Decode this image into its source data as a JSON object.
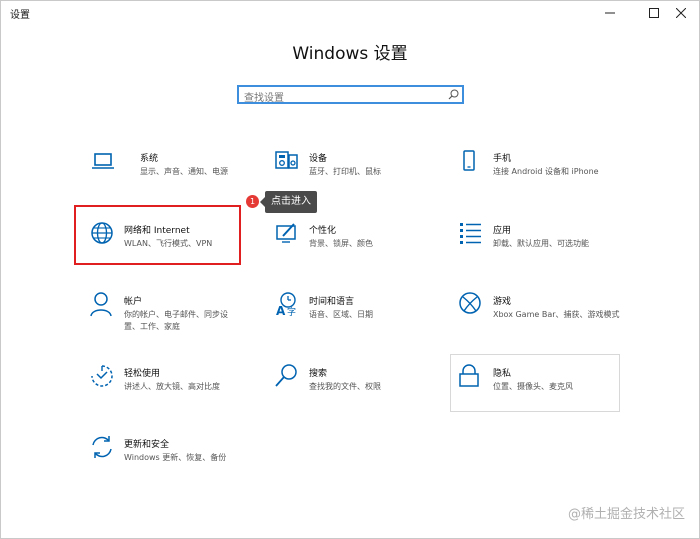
{
  "window": {
    "title": "设置"
  },
  "page": {
    "title": "Windows 设置"
  },
  "search": {
    "placeholder": "查找设置"
  },
  "callout": {
    "badge": "1",
    "text": "点击进入"
  },
  "tiles": [
    {
      "id": "system",
      "title": "系统",
      "subtitle": "显示、声音、通知、电源",
      "icon": "laptop-icon"
    },
    {
      "id": "devices",
      "title": "设备",
      "subtitle": "蓝牙、打印机、鼠标",
      "icon": "devices-icon"
    },
    {
      "id": "phone",
      "title": "手机",
      "subtitle": "连接 Android 设备和 iPhone",
      "icon": "phone-icon"
    },
    {
      "id": "network",
      "title": "网络和 Internet",
      "subtitle": "WLAN、飞行模式、VPN",
      "icon": "globe-icon"
    },
    {
      "id": "personalization",
      "title": "个性化",
      "subtitle": "背景、锁屏、颜色",
      "icon": "pen-screen-icon"
    },
    {
      "id": "apps",
      "title": "应用",
      "subtitle": "卸载、默认应用、可选功能",
      "icon": "apps-list-icon"
    },
    {
      "id": "accounts",
      "title": "帐户",
      "subtitle": "你的帐户、电子邮件、同步设置、工作、家庭",
      "icon": "person-icon"
    },
    {
      "id": "time",
      "title": "时间和语言",
      "subtitle": "语音、区域、日期",
      "icon": "time-language-icon"
    },
    {
      "id": "gaming",
      "title": "游戏",
      "subtitle": "Xbox Game Bar、捕获、游戏模式",
      "icon": "xbox-icon"
    },
    {
      "id": "ease",
      "title": "轻松使用",
      "subtitle": "讲述人、放大镜、高对比度",
      "icon": "ease-of-access-icon"
    },
    {
      "id": "search",
      "title": "搜索",
      "subtitle": "查找我的文件、权限",
      "icon": "search-icon"
    },
    {
      "id": "privacy",
      "title": "隐私",
      "subtitle": "位置、摄像头、麦克风",
      "icon": "lock-icon"
    },
    {
      "id": "update",
      "title": "更新和安全",
      "subtitle": "Windows 更新、恢复、备份",
      "icon": "sync-icon"
    }
  ],
  "watermark": "@稀土掘金技术社区",
  "colors": {
    "accent": "#0063b1",
    "highlight": "#e02020",
    "search_border": "#3e8ede"
  }
}
